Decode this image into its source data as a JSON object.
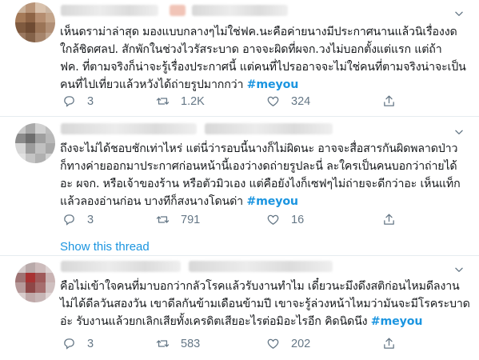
{
  "tweets": [
    {
      "lines": [
        "เห็นดราม่าล่าสุด มองแบบกลางๆไม่ใช่ฟค.นะคือค่ายนางมีประกาศนานแล้วนิเรื่องงด",
        "ใกล้ชิดศลป. สักพักในช่วงไวรัสระบาด อาจจะผิดที่ผจก.วงไม่บอกตั้งแต่แรก แต่ถ้า",
        "ฟค. ที่ตามจริงก็น่าจะรู้เรื่องประกาศนี้ แต่คนที่ไปรออาจจะไม่ใช่คนที่ตามจริงน่าจะเป็น",
        "คนที่ไปเที่ยวแล้วหวังได้ถ่ายรูปมากกว่า"
      ],
      "hashtag": "#meyou",
      "replies": "3",
      "retweets": "1.2K",
      "likes": "324"
    },
    {
      "lines": [
        "ถึงจะไม่ได้ชอบชักเท่าไหร่ แต่นี่ว่ารอบนี้นางก็ไม่ผิดนะ อาจจะสื่อสารกันผิดพลาดป่าว",
        "ก็ทางค่ายออกมาประกาศก่อนหน้านี้เองว่างดถ่ายรูปละนี่ ละใครเป็นคนบอกว่าถ่ายได้",
        "อะ ผจก. หรือเจ้าของร้าน หรือตัวมิวเอง แต่คือยังไงก็เซฟๆไม่ถ่ายจะดีกว่าอะ เห็นแท็ก",
        "แล้วลองอ่านก่อน บางทีก็สงนางโดนด่า"
      ],
      "hashtag": "#meyou",
      "replies": "3",
      "retweets": "791",
      "likes": "16",
      "show_thread": "Show this thread"
    },
    {
      "lines": [
        "คือไม่เข้าใจคนที่มาบอกว่ากลัวโรคแล้วรับงานทำไม เดี๋ยวนะมึงดึงสติก่อนไหมดีลงาน",
        "ไม่ได้ดีลวันสองวัน เขาดีลกันข้ามเดือนข้ามปี เขาจะรู้ล่วงหน้าไหมว่ามันจะมีโรคระบาด",
        "อ่ะ รับงานแล้วยกเลิกเสียทั้งเครดิตเสียอะไรต่อมิอะไรอีก คิดนิดนึง"
      ],
      "hashtag": "#meyou",
      "replies": "3",
      "retweets": "583",
      "likes": "202"
    }
  ]
}
